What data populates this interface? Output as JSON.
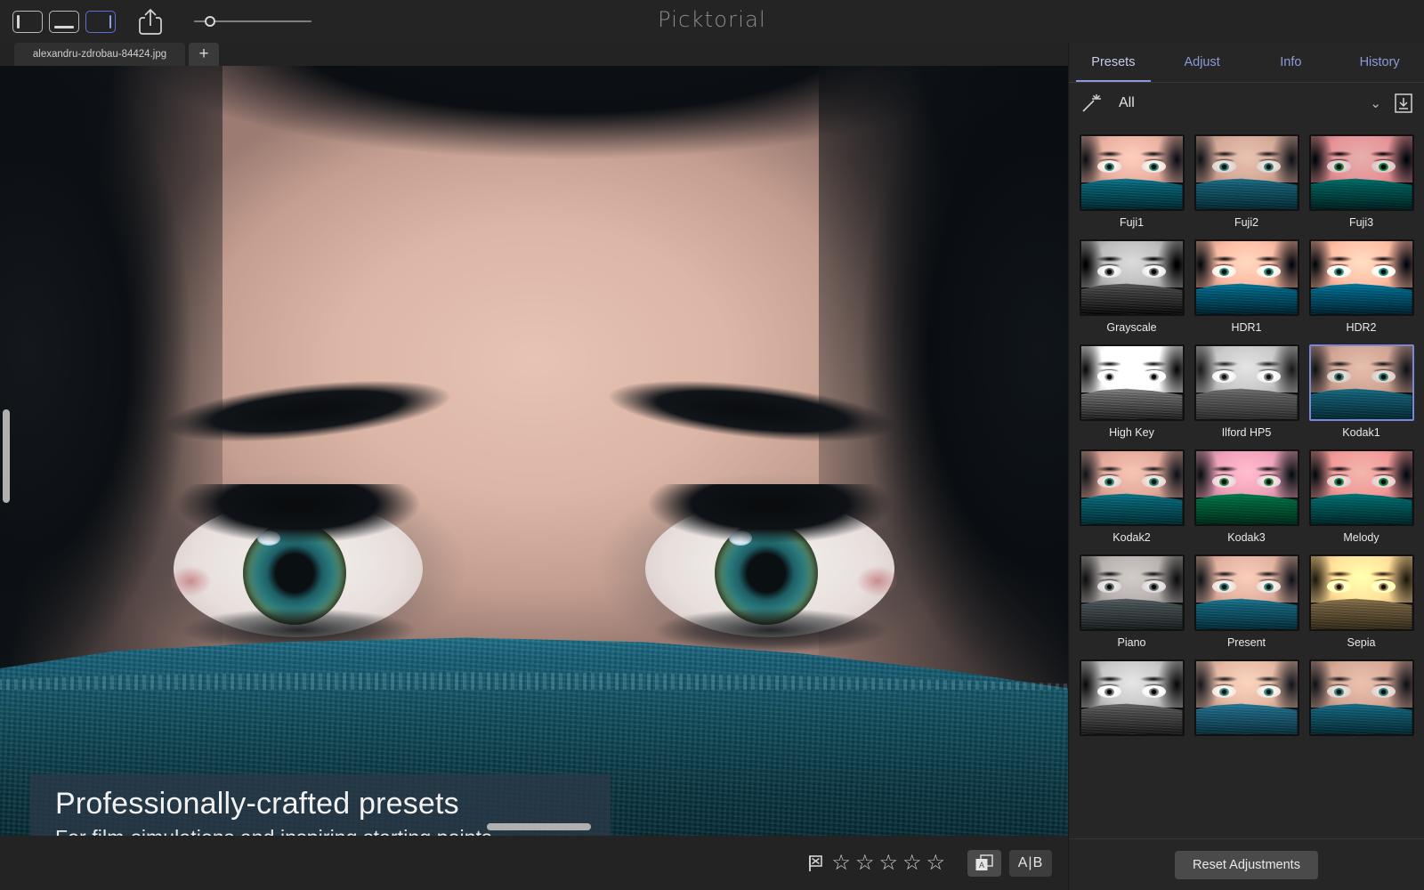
{
  "app": {
    "title": "Picktorial"
  },
  "toolbar": {
    "panel_toggles": [
      {
        "name": "left-panel-toggle",
        "active": false
      },
      {
        "name": "bottom-panel-toggle",
        "active": false
      },
      {
        "name": "right-panel-toggle",
        "active": true
      }
    ],
    "share_icon": "share-icon",
    "zoom_slider": {
      "name": "zoom-slider",
      "value_percent": 14
    }
  },
  "tabstrip": {
    "file_tab_label": "alexandru-zdrobau-84424.jpg",
    "new_tab_label": "+"
  },
  "caption": {
    "heading": "Professionally-crafted presets",
    "subheading": "For film-simulations and inspiring starting points"
  },
  "bottombar": {
    "flag_icon": "reject-flag-icon",
    "stars": [
      "☆",
      "☆",
      "☆",
      "☆",
      "☆"
    ],
    "rating_value": 0,
    "copy_adjustments_icon": "copy-adjustments-icon",
    "compare_label": "A|B"
  },
  "right_panel": {
    "tabs": [
      {
        "label": "Presets",
        "active": true
      },
      {
        "label": "Adjust",
        "active": false
      },
      {
        "label": "Info",
        "active": false
      },
      {
        "label": "History",
        "active": false
      }
    ],
    "filter": {
      "wand_icon": "magic-wand-icon",
      "selected": "All",
      "chevron": "⌄",
      "import_icon": "import-preset-icon"
    },
    "presets": [
      {
        "label": "Fuji1",
        "selected": false,
        "tone": "fuji1"
      },
      {
        "label": "Fuji2",
        "selected": false,
        "tone": "fuji2"
      },
      {
        "label": "Fuji3",
        "selected": false,
        "tone": "fuji3"
      },
      {
        "label": "Grayscale",
        "selected": false,
        "tone": "grayscale"
      },
      {
        "label": "HDR1",
        "selected": false,
        "tone": "hdr1"
      },
      {
        "label": "HDR2",
        "selected": false,
        "tone": "hdr2"
      },
      {
        "label": "High Key",
        "selected": false,
        "tone": "highkey"
      },
      {
        "label": "Ilford HP5",
        "selected": false,
        "tone": "ilford"
      },
      {
        "label": "Kodak1",
        "selected": true,
        "tone": "kodak1"
      },
      {
        "label": "Kodak2",
        "selected": false,
        "tone": "kodak2"
      },
      {
        "label": "Kodak3",
        "selected": false,
        "tone": "kodak3"
      },
      {
        "label": "Melody",
        "selected": false,
        "tone": "melody"
      },
      {
        "label": "Piano",
        "selected": false,
        "tone": "piano"
      },
      {
        "label": "Present",
        "selected": false,
        "tone": "present"
      },
      {
        "label": "Sepia",
        "selected": false,
        "tone": "sepia"
      },
      {
        "label": "",
        "selected": false,
        "tone": "rowbw"
      },
      {
        "label": "",
        "selected": false,
        "tone": "rowwarm"
      },
      {
        "label": "",
        "selected": false,
        "tone": "rowcool"
      }
    ],
    "reset_button_label": "Reset Adjustments"
  },
  "colors": {
    "accent": "#7b86d8",
    "tab_text": "#8e9ad8",
    "panel_bg": "#262626",
    "toolbar_bg": "#242424",
    "button_bg": "#4a4a4a",
    "scarf_teal": "#17515f"
  }
}
